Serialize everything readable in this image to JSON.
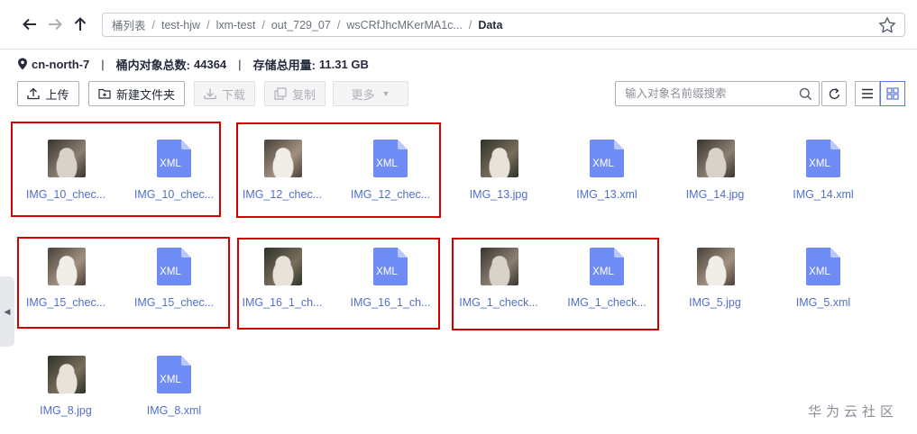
{
  "navigation": {
    "back_icon": "arrow-left-icon",
    "forward_icon": "arrow-right-icon",
    "up_icon": "arrow-up-icon",
    "breadcrumb": [
      "桶列表",
      "test-hjw",
      "lxm-test",
      "out_729_07",
      "wsCRfJhcMKerMA1c..."
    ],
    "current": "Data",
    "separator": "/",
    "favorite_icon": "star-icon"
  },
  "info": {
    "region": "cn-north-7",
    "object_count_label": "桶内对象总数:",
    "object_count": "44364",
    "storage_label": "存储总用量:",
    "storage_value": "11.31 GB",
    "divider": "|"
  },
  "toolbar": {
    "upload": "上传",
    "new_folder": "新建文件夹",
    "download": "下载",
    "copy": "复制",
    "more": "更多"
  },
  "search": {
    "placeholder": "输入对象名前缀搜索"
  },
  "files": [
    {
      "name": "IMG_10_chec...",
      "kind": "image"
    },
    {
      "name": "IMG_10_chec...",
      "kind": "xml"
    },
    {
      "name": "IMG_12_chec...",
      "kind": "image"
    },
    {
      "name": "IMG_12_chec...",
      "kind": "xml"
    },
    {
      "name": "IMG_13.jpg",
      "kind": "image"
    },
    {
      "name": "IMG_13.xml",
      "kind": "xml"
    },
    {
      "name": "IMG_14.jpg",
      "kind": "image"
    },
    {
      "name": "IMG_14.xml",
      "kind": "xml"
    },
    {
      "name": "IMG_15_chec...",
      "kind": "image"
    },
    {
      "name": "IMG_15_chec...",
      "kind": "xml"
    },
    {
      "name": "IMG_16_1_ch...",
      "kind": "image"
    },
    {
      "name": "IMG_16_1_ch...",
      "kind": "xml"
    },
    {
      "name": "IMG_1_check...",
      "kind": "image"
    },
    {
      "name": "IMG_1_check...",
      "kind": "xml"
    },
    {
      "name": "IMG_5.jpg",
      "kind": "image"
    },
    {
      "name": "IMG_5.xml",
      "kind": "xml"
    },
    {
      "name": "IMG_8.jpg",
      "kind": "image"
    },
    {
      "name": "IMG_8.xml",
      "kind": "xml"
    }
  ],
  "xml_badge": "XML",
  "colors": {
    "link": "#526ecc",
    "xml_icon": "#6f8cf5",
    "highlight_box": "#d40000"
  },
  "watermark": "华为云社区"
}
